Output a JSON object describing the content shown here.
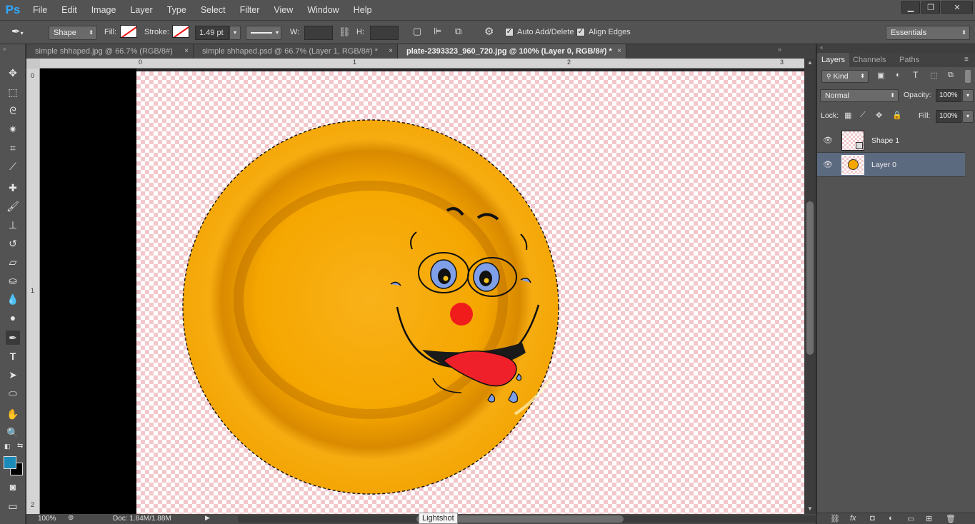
{
  "app": {
    "logo": "Ps"
  },
  "menu": [
    "File",
    "Edit",
    "Image",
    "Layer",
    "Type",
    "Select",
    "Filter",
    "View",
    "Window",
    "Help"
  ],
  "window_controls": {
    "minimize": "▁",
    "restore": "❐",
    "close": "✕"
  },
  "options": {
    "mode": "Shape",
    "fill_label": "Fill:",
    "stroke_label": "Stroke:",
    "stroke_width": "1.49 pt",
    "w_label": "W:",
    "h_label": "H:",
    "auto_add_delete": "Auto Add/Delete",
    "align_edges": "Align Edges",
    "workspace": "Essentials"
  },
  "tabs": [
    {
      "label": "simple shhaped.jpg @ 66.7% (RGB/8#)",
      "close": "×"
    },
    {
      "label": "simple shhaped.psd @ 66.7% (Layer 1, RGB/8#) *",
      "close": "×"
    },
    {
      "label": "plate-2393323_960_720.jpg @ 100% (Layer 0, RGB/8#) *",
      "close": "×"
    }
  ],
  "ruler": {
    "h_ticks": [
      "0",
      "1",
      "2",
      "3"
    ],
    "v_ticks": [
      "0",
      "1",
      "2"
    ]
  },
  "status": {
    "zoom": "100%",
    "doc": "Doc: 1.84M/1.88M"
  },
  "tooltip": "Lightshot",
  "layers_panel": {
    "tabs": [
      "Layers",
      "Channels",
      "Paths"
    ],
    "filter": "Kind",
    "blend_mode": "Normal",
    "opacity_label": "Opacity:",
    "opacity": "100%",
    "lock_label": "Lock:",
    "fill_label": "Fill:",
    "fill": "100%",
    "layers": [
      {
        "name": "Shape 1"
      },
      {
        "name": "Layer 0"
      }
    ]
  },
  "colors": {
    "foreground": "#1a8ab8",
    "background": "#000000",
    "plate": "#f5a800",
    "accent": "#31a8ff"
  }
}
